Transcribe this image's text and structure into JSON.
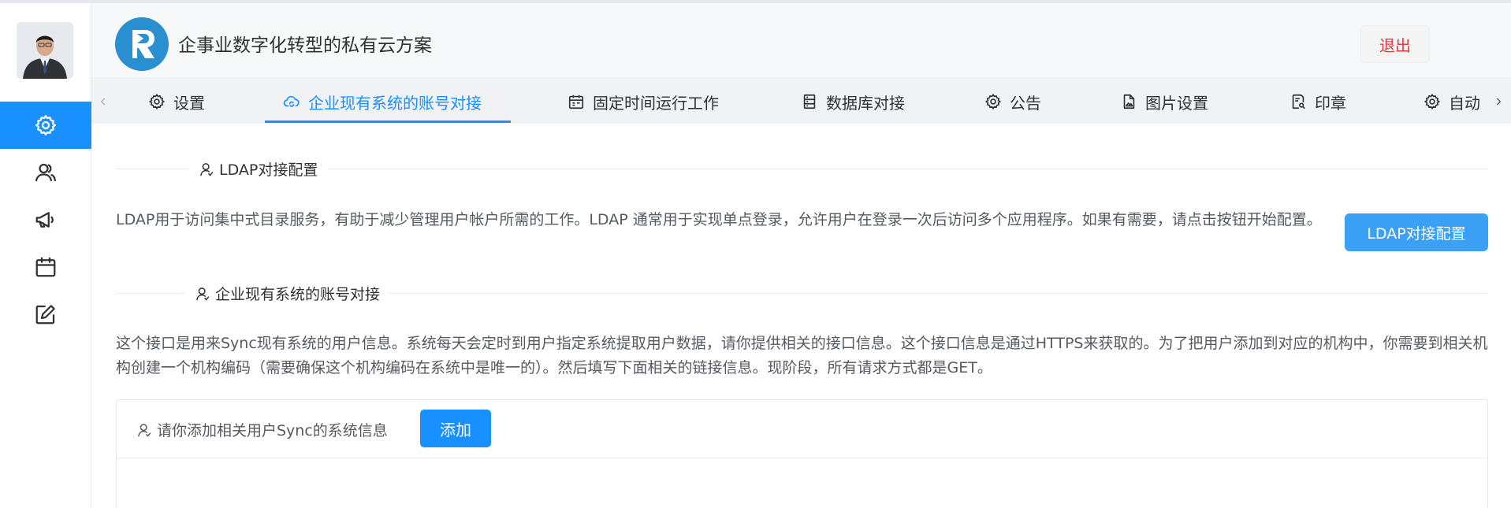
{
  "header": {
    "app_title": "企事业数字化转型的私有云方案",
    "logout_label": "退出"
  },
  "sidebar": {
    "items": [
      {
        "icon": "gear-icon",
        "active": true
      },
      {
        "icon": "users-icon",
        "active": false
      },
      {
        "icon": "megaphone-icon",
        "active": false
      },
      {
        "icon": "calendar-icon",
        "active": false
      },
      {
        "icon": "edit-icon",
        "active": false
      }
    ]
  },
  "tabs": {
    "items": [
      {
        "label": "设置",
        "icon": "gear-icon"
      },
      {
        "label": "企业现有系统的账号对接",
        "icon": "cloud-sync-icon",
        "active": true
      },
      {
        "label": "固定时间运行工作",
        "icon": "calendar-icon"
      },
      {
        "label": "数据库对接",
        "icon": "database-icon"
      },
      {
        "label": "公告",
        "icon": "gear-icon"
      },
      {
        "label": "图片设置",
        "icon": "image-file-icon"
      },
      {
        "label": "印章",
        "icon": "stamp-icon"
      },
      {
        "label": "自动",
        "icon": "gear-icon"
      }
    ]
  },
  "ldap_section": {
    "title": "LDAP对接配置",
    "description": "LDAP用于访问集中式目录服务，有助于减少管理用户帐户所需的工作。LDAP 通常用于实现单点登录，允许用户在登录一次后访问多个应用程序。如果有需要，请点击按钮开始配置。",
    "button_label": "LDAP对接配置"
  },
  "sync_section": {
    "title": "企业现有系统的账号对接",
    "description": "这个接口是用来Sync现有系统的用户信息。系统每天会定时到用户指定系统提取用户数据，请你提供相关的接口信息。这个接口信息是通过HTTPS来获取的。为了把用户添加到对应的机构中，你需要到相关机构创建一个机构编码（需要确保这个机构编码在系统中是唯一的）。然后填写下面相关的链接信息。现阶段，所有请求方式都是GET。",
    "card_label": "请你添加相关用户Sync的系统信息",
    "add_label": "添加"
  },
  "colors": {
    "primary": "#1890ff",
    "ldap_button": "#3aa1f7",
    "logout_text": "#e4393c",
    "logo_bg": "#2a8fd1"
  }
}
